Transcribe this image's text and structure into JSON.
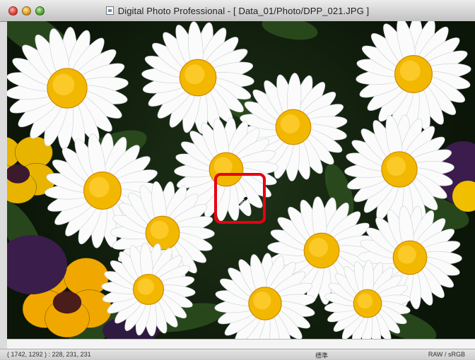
{
  "window": {
    "title": "Digital Photo Professional - [ Data_01/Photo/DPP_021.JPG ]"
  },
  "viewer": {
    "image_description_icon": "eyedropper-cursor-icon",
    "highlight_color": "#e60012"
  },
  "status": {
    "coords_rgb": "( 1742, 1292 ) : 228, 231, 231",
    "style": "標準",
    "mode": "RAW / sRGB"
  }
}
